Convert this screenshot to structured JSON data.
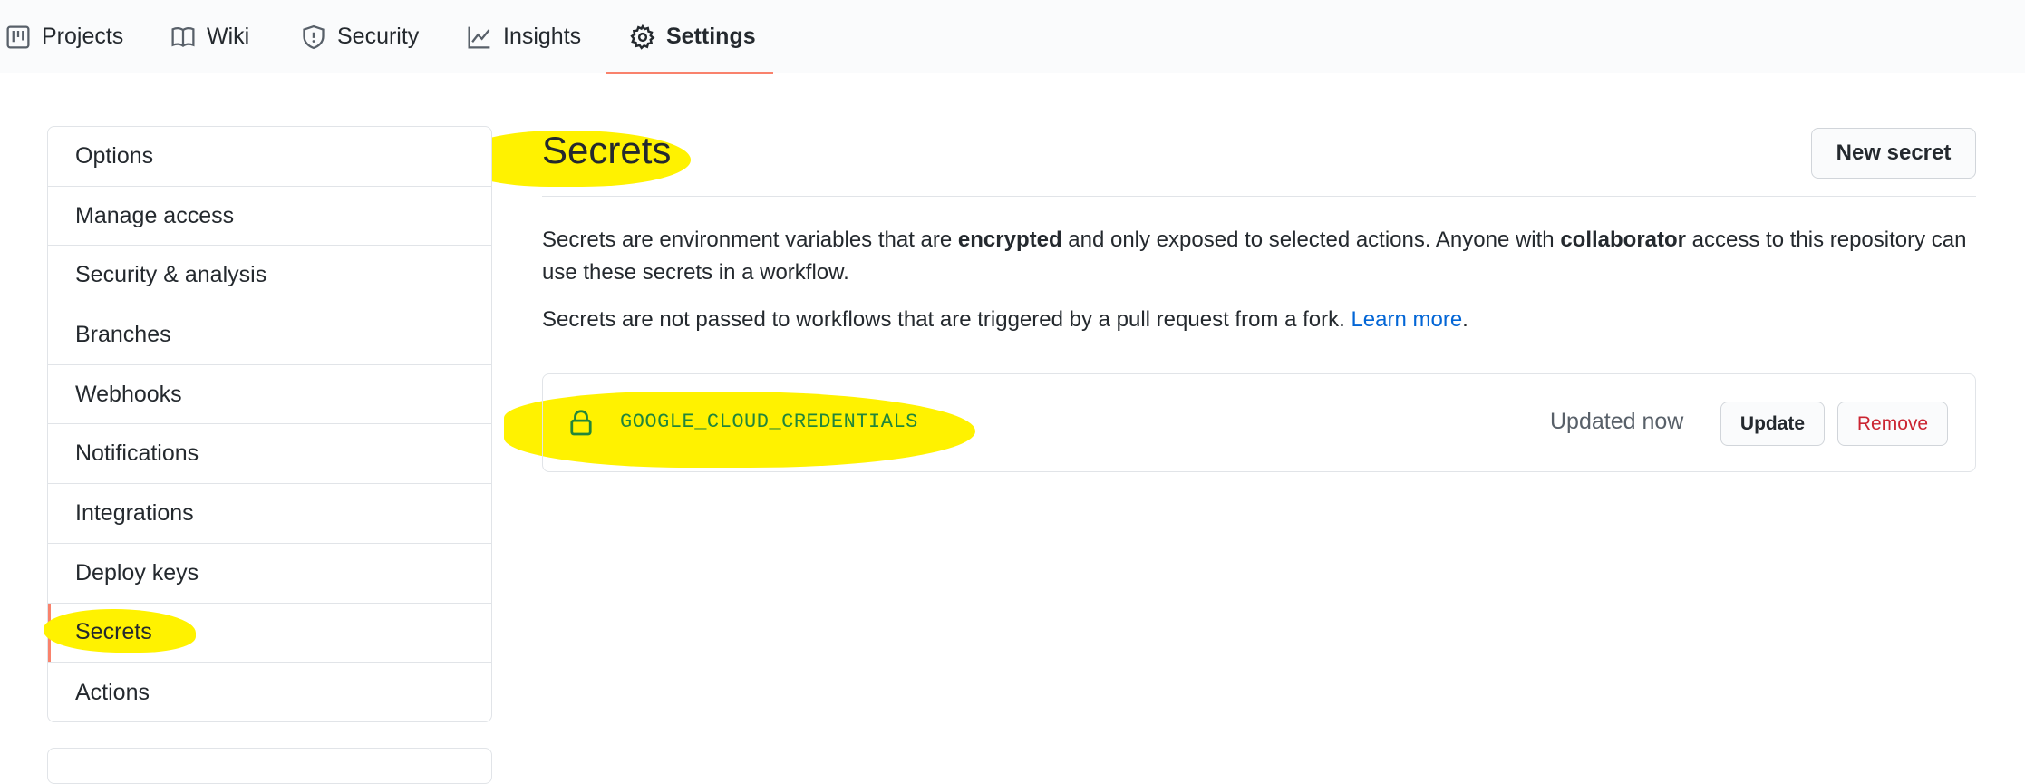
{
  "tabs": [
    {
      "label": "Projects",
      "icon": "project-icon"
    },
    {
      "label": "Wiki",
      "icon": "book-icon"
    },
    {
      "label": "Security",
      "icon": "shield-icon"
    },
    {
      "label": "Insights",
      "icon": "graph-icon"
    },
    {
      "label": "Settings",
      "icon": "gear-icon",
      "selected": true
    }
  ],
  "sidebar": {
    "items": [
      {
        "label": "Options"
      },
      {
        "label": "Manage access"
      },
      {
        "label": "Security & analysis"
      },
      {
        "label": "Branches"
      },
      {
        "label": "Webhooks"
      },
      {
        "label": "Notifications"
      },
      {
        "label": "Integrations"
      },
      {
        "label": "Deploy keys"
      },
      {
        "label": "Secrets",
        "selected": true
      },
      {
        "label": "Actions"
      }
    ]
  },
  "main": {
    "title": "Secrets",
    "new_secret_label": "New secret",
    "desc1_part1": "Secrets are environment variables that are ",
    "desc1_bold1": "encrypted",
    "desc1_part2": " and only exposed to selected actions. Anyone with ",
    "desc1_bold2": "collaborator",
    "desc1_part3": " access to this repository can use these secrets in a workflow.",
    "desc2_text": "Secrets are not passed to workflows that are triggered by a pull request from a fork. ",
    "desc2_link": "Learn more",
    "desc2_end": ".",
    "secret": {
      "name": "GOOGLE_CLOUD_CREDENTIALS",
      "icon": "lock-icon",
      "status": "Updated now",
      "update_label": "Update",
      "remove_label": "Remove"
    }
  },
  "colors": {
    "accent_underline": "#f9826c",
    "link": "#0366d6",
    "secret_name": "#22863a",
    "remove": "#cb2431",
    "highlight": "#fff200"
  }
}
